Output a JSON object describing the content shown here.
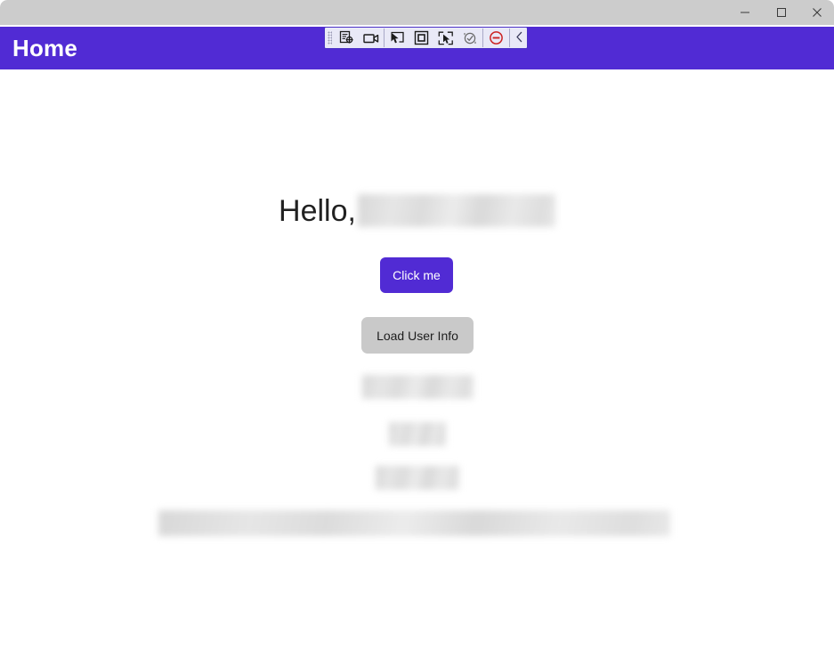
{
  "window": {
    "titlebar_text": "",
    "controls": [
      {
        "name": "minimize",
        "glyph": "minimize-icon",
        "tooltip": "Minimize"
      },
      {
        "name": "maximize",
        "glyph": "maximize-icon",
        "tooltip": "Maximize"
      },
      {
        "name": "close",
        "glyph": "close-icon",
        "tooltip": "Close"
      }
    ],
    "background_color": "#cccccc"
  },
  "automation_toolbar": {
    "background_color": "#e9e9f7",
    "border_color": "#4a31c4",
    "drag_handle": "drag-grip-icon",
    "buttons": [
      {
        "name": "inspect-settings",
        "icon": "inspect-element-icon",
        "label": "Inspect"
      },
      {
        "name": "record",
        "icon": "video-camera-icon",
        "label": "Record"
      },
      {
        "name": "pick-element",
        "icon": "cursor-pointer-icon",
        "label": "Pick element"
      },
      {
        "name": "highlight-element",
        "icon": "square-outline-icon",
        "label": "Highlight"
      },
      {
        "name": "select-region",
        "icon": "cursor-selection-icon",
        "label": "Select region"
      },
      {
        "name": "assert-value",
        "icon": "check-circle-icon",
        "label": "Assert"
      },
      {
        "name": "stop",
        "icon": "stop-circle-icon",
        "label": "Stop",
        "color": "#cc2222"
      }
    ],
    "collapse": {
      "name": "collapse",
      "icon": "chevron-left-icon",
      "label": "Collapse toolbar"
    }
  },
  "page": {
    "header": {
      "title": "Home",
      "background_color": "#512BD4",
      "text_color": "#ffffff"
    },
    "greeting": {
      "prefix": "Hello,",
      "name_redacted": true
    },
    "buttons": [
      {
        "name": "click-me",
        "label": "Click me",
        "background_color": "#512BD4",
        "text_color": "#ffffff"
      },
      {
        "name": "load-user-info",
        "label": "Load User Info",
        "background_color": "#c9c9c9",
        "text_color": "#1d1d1d"
      }
    ],
    "redacted_blocks": [
      {
        "name": "user-info-line-1",
        "redacted": true
      },
      {
        "name": "user-info-line-2",
        "redacted": true
      },
      {
        "name": "user-info-line-3",
        "redacted": true
      },
      {
        "name": "user-info-wide-bar",
        "redacted": true
      }
    ]
  }
}
